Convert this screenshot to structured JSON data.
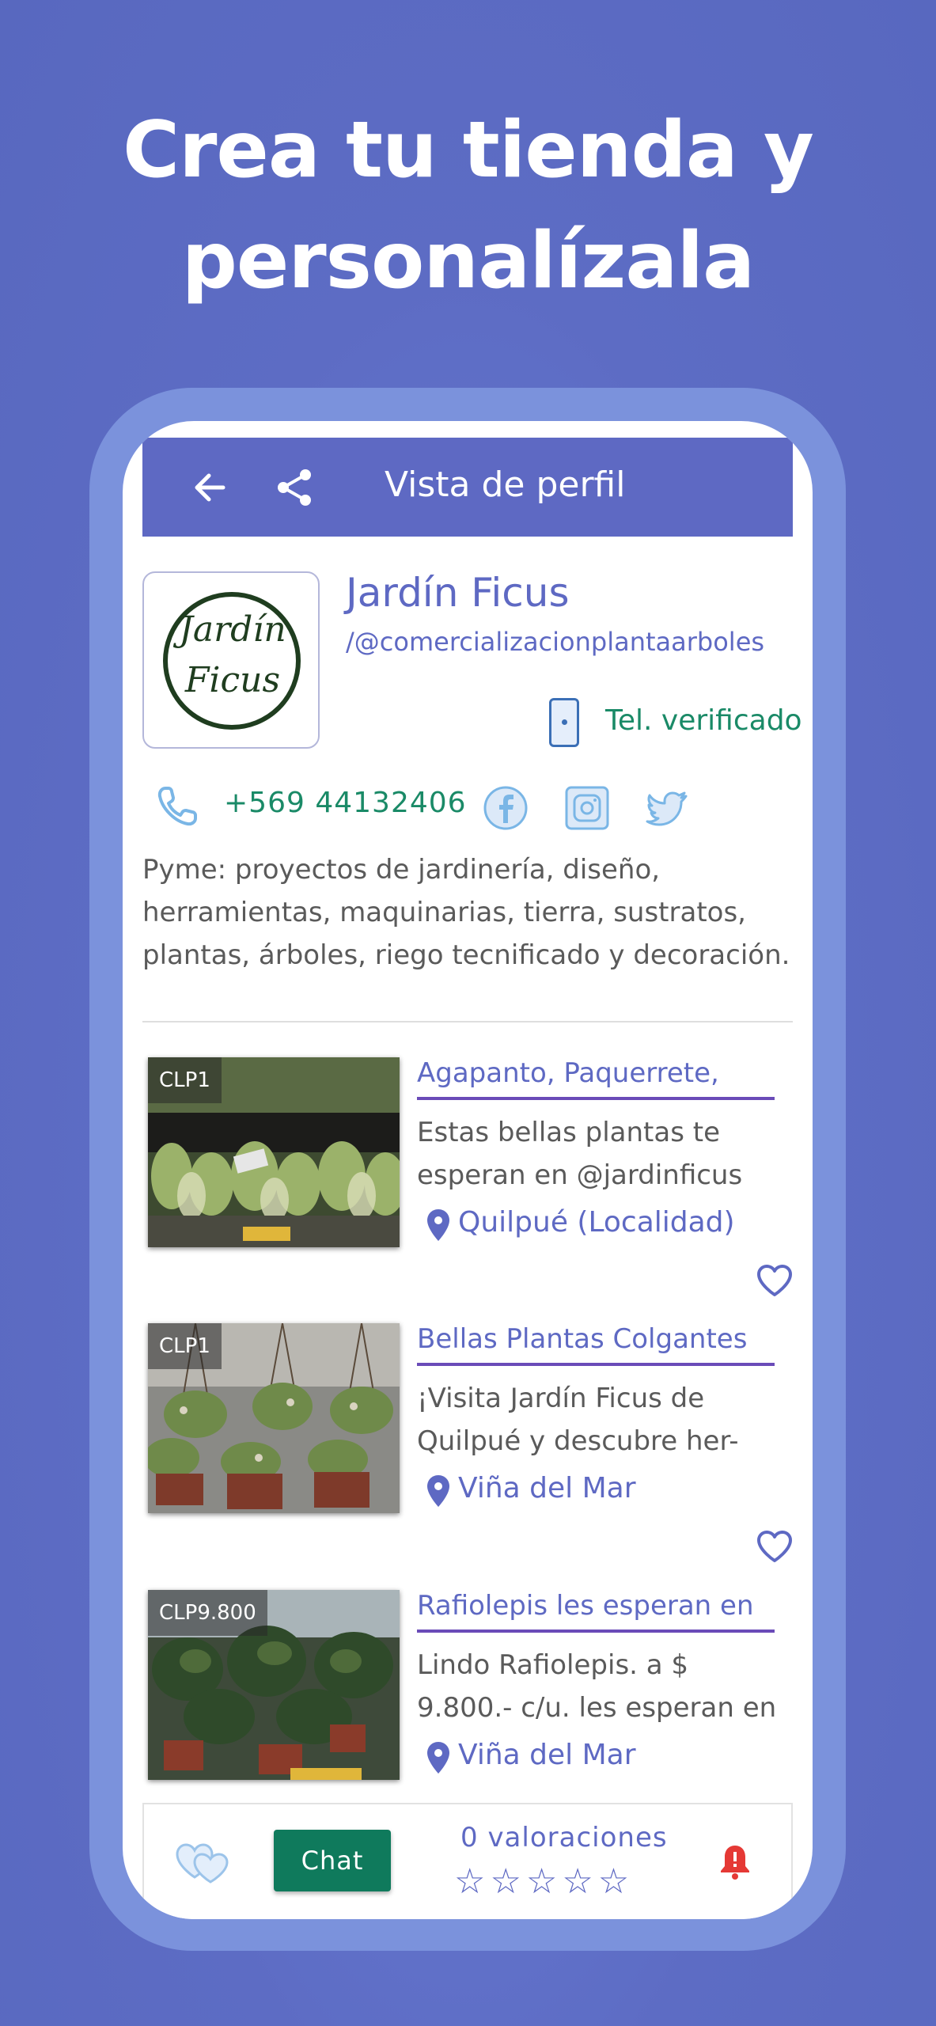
{
  "headline": {
    "line1": "Crea tu tienda y",
    "line2": "personalízala"
  },
  "appbar": {
    "title": "Vista de perfil"
  },
  "profile": {
    "logo_text_1": "Jardín",
    "logo_text_2": "Ficus",
    "name": "Jardín Ficus",
    "handle": "/@comercializacionplantaarboles",
    "verified_label": "Tel. verificado",
    "phone": "+569 44132406",
    "description": "Pyme: proyectos de jardinería, diseño, herramientas, maquinarias, tierra, sustratos, plantas, árboles, riego tecnificado y decoración."
  },
  "listings": [
    {
      "price": "CLP1",
      "title": "Agapanto, Paquerrete,",
      "description": "Estas bellas plantas te esperan en @jardinficus",
      "location": "Quilpué (Localidad)"
    },
    {
      "price": "CLP1",
      "title": "Bellas Plantas Colgantes",
      "description": "¡Visita  Jardín Ficus de Quilpué y descubre her-",
      "location": "Viña del Mar"
    },
    {
      "price": "CLP9.800",
      "title": "Rafiolepis les esperan en",
      "description": "Lindo Rafiolepis. a $ 9.800.- c/u. les esperan en",
      "location": "Viña del Mar"
    }
  ],
  "bottom_bar": {
    "chat_label": "Chat",
    "ratings_text": "0 valoraciones",
    "stars": "☆☆☆☆☆",
    "rating_value": 0,
    "rating_max": 5
  },
  "colors": {
    "background": "#5d6cc4",
    "accent": "#5e69c3",
    "green": "#1a8a67",
    "chat_button": "#0f7a5c",
    "bell": "#e53935"
  },
  "icons": [
    "back-arrow-icon",
    "share-icon",
    "mobile-phone-icon",
    "phone-call-icon",
    "facebook-icon",
    "instagram-icon",
    "twitter-icon",
    "location-pin-icon",
    "heart-icon",
    "hearts-icon",
    "bell-icon"
  ]
}
